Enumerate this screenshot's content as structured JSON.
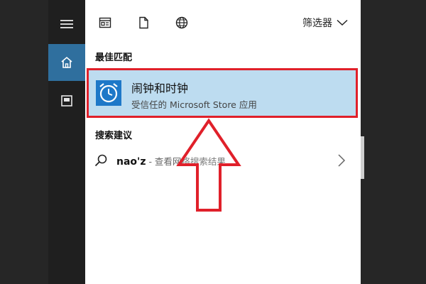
{
  "topbar": {
    "filter_label": "筛选器",
    "icons": [
      "apps-icon",
      "document-icon",
      "globe-icon"
    ]
  },
  "rail": {
    "items": [
      "hamburger-menu-icon",
      "home-icon",
      "recent-documents-icon"
    ],
    "active": "home-icon"
  },
  "best_match": {
    "section_label": "最佳匹配",
    "app_name": "闹钟和时钟",
    "app_subtitle": "受信任的 Microsoft Store 应用",
    "icon": "alarm-clock-icon"
  },
  "suggestions": {
    "section_label": "搜索建议",
    "items": [
      {
        "query": "nao'z",
        "suffix": " - 查看网络搜索结果",
        "icon": "search-icon"
      }
    ]
  },
  "colors": {
    "accent": "#2f6f9e",
    "selection": "#bddcf0",
    "annotation": "#e0202a"
  }
}
